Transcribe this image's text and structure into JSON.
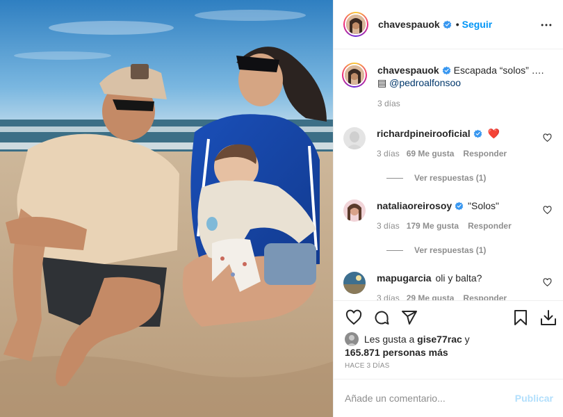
{
  "post": {
    "author": "chavespauok",
    "follow_label": "Seguir",
    "dot": "•",
    "caption_text": "Escapada “solos” …. ",
    "caption_emoji": "▤",
    "caption_mention": "@pedroalfonsoo",
    "caption_time": "3 días"
  },
  "comments": [
    {
      "user": "richardpineirooficial",
      "text": "",
      "emoji": "❤️",
      "time": "3 días",
      "likes": "69 Me gusta",
      "reply": "Responder",
      "view_replies": "Ver respuestas (1)"
    },
    {
      "user": "nataliaoreirosoy",
      "text": "\"Solos\"",
      "time": "3 días",
      "likes": "179 Me gusta",
      "reply": "Responder",
      "view_replies": "Ver respuestas (1)"
    },
    {
      "user": "mapugarcia",
      "text": "oli y balta?",
      "time": "3 días",
      "likes": "29 Me gusta",
      "reply": "Responder"
    }
  ],
  "likes_line": {
    "prefix": "Les gusta a",
    "user": "gise77rac",
    "connector": "y",
    "count": "165.871 personas más"
  },
  "time_ago": "HACE 3 DÍAS",
  "add_comment": {
    "placeholder": "Añade un comentario...",
    "publish": "Publicar"
  },
  "colors": {
    "link": "#0095f6",
    "mention": "#00376b",
    "muted": "#8e8e8e",
    "disabled_publish": "#b2dffc",
    "verified": "#3897f0"
  },
  "icons": [
    "more-icon",
    "heart-icon",
    "comment-icon",
    "share-icon",
    "bookmark-icon",
    "download-icon",
    "verified-icon"
  ]
}
